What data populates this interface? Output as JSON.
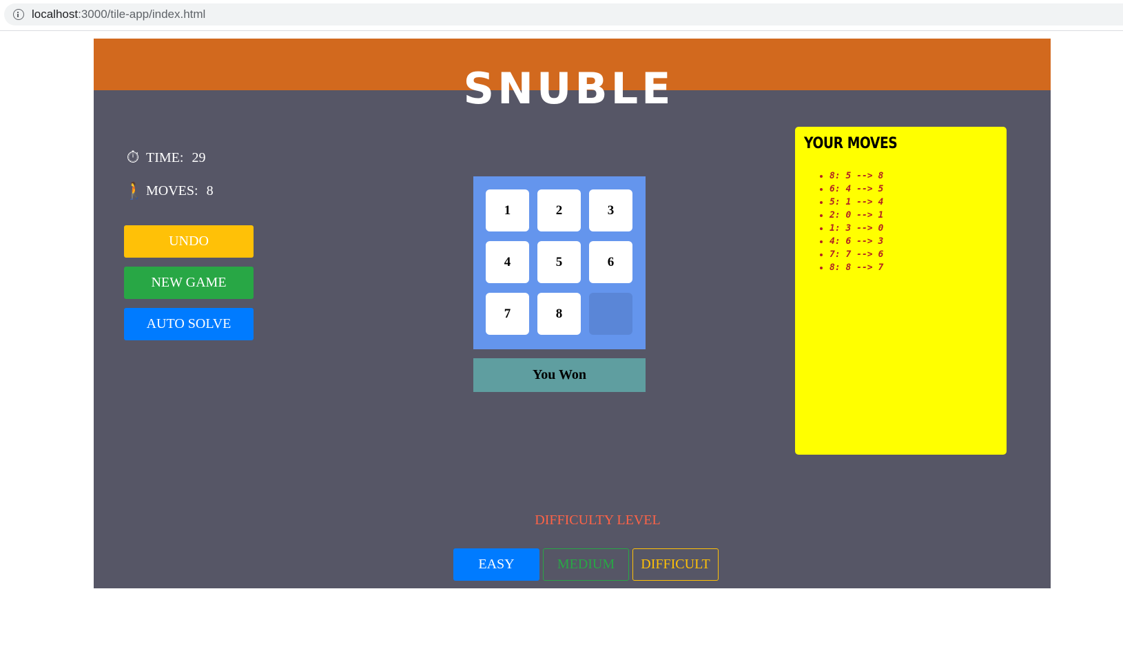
{
  "browser": {
    "url_host": "localhost",
    "url_path": ":3000/tile-app/index.html"
  },
  "app": {
    "title": "SNUBLE"
  },
  "stats": {
    "time_icon": "⏱",
    "time_label": "TIME:",
    "time_value": "29",
    "moves_icon": "🚶",
    "moves_label": "MOVES:",
    "moves_value": "8"
  },
  "controls": {
    "undo_label": "UNDO",
    "new_game_label": "NEW GAME",
    "auto_solve_label": "AUTO SOLVE"
  },
  "board": {
    "tiles": [
      "1",
      "2",
      "3",
      "4",
      "5",
      "6",
      "7",
      "8",
      ""
    ],
    "status": "You Won"
  },
  "moves_panel": {
    "title": "YOUR MOVES",
    "moves": [
      "8: 5 --> 8",
      "6: 4 --> 5",
      "5: 1 --> 4",
      "2: 0 --> 1",
      "1: 3 --> 0",
      "4: 6 --> 3",
      "7: 7 --> 6",
      "8: 8 --> 7"
    ]
  },
  "difficulty": {
    "label": "DIFFICULTY LEVEL",
    "easy_label": "EASY",
    "medium_label": "MEDIUM",
    "difficult_label": "DIFFICULT",
    "selected": "EASY"
  },
  "colors": {
    "header": "#d2691e",
    "background": "#565666",
    "board": "#6495ed",
    "status": "#5f9ea0",
    "moves_panel": "#ffff00",
    "undo": "#ffc107",
    "new_game": "#28a745",
    "auto_solve": "#007bff",
    "difficulty_label": "#ff6347"
  }
}
